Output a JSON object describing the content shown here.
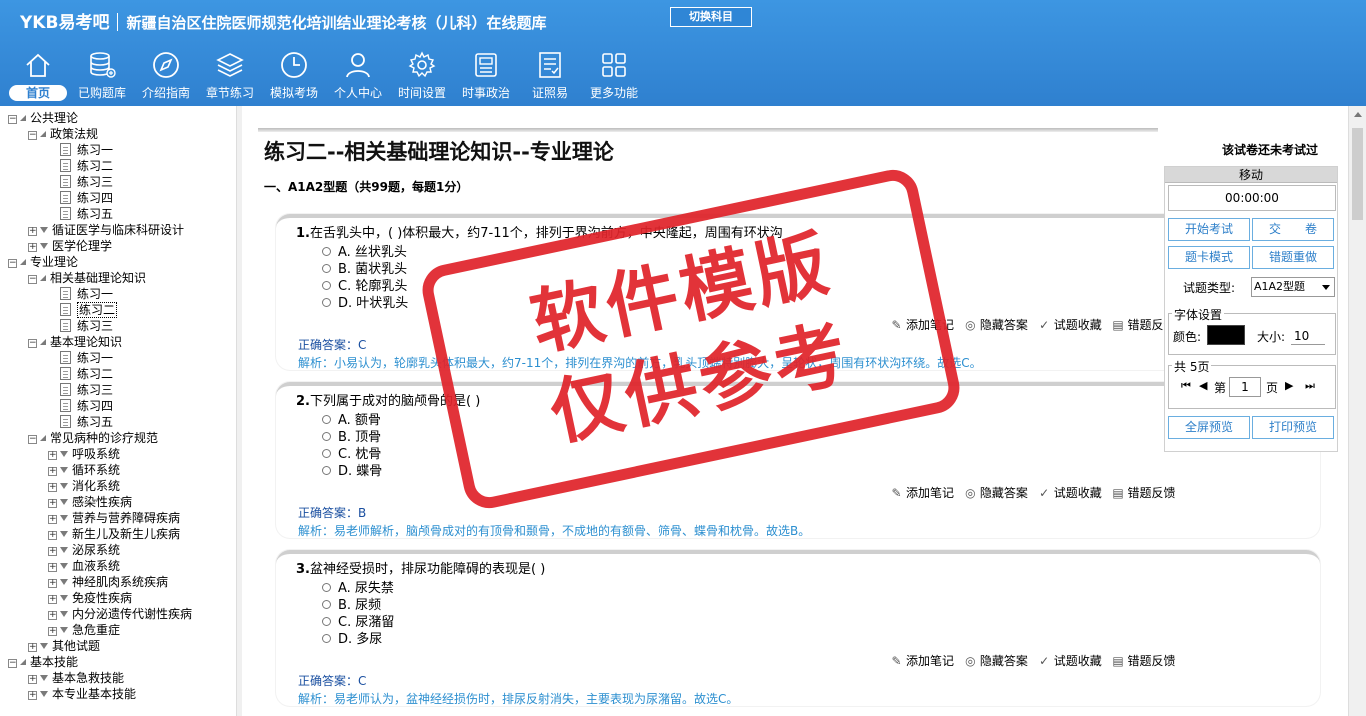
{
  "header": {
    "logo": "YKB易考吧",
    "title": "新疆自治区住院医师规范化培训结业理论考核（儿科）在线题库",
    "switch_label": "切换科目"
  },
  "nav": [
    {
      "label": "首页",
      "icon": "home-icon"
    },
    {
      "label": "已购题库",
      "icon": "database-icon"
    },
    {
      "label": "介绍指南",
      "icon": "compass-icon"
    },
    {
      "label": "章节练习",
      "icon": "layers-icon"
    },
    {
      "label": "模拟考场",
      "icon": "clock-icon"
    },
    {
      "label": "个人中心",
      "icon": "user-icon"
    },
    {
      "label": "时间设置",
      "icon": "gear-icon"
    },
    {
      "label": "时事政治",
      "icon": "news-icon"
    },
    {
      "label": "证照易",
      "icon": "checklist-icon"
    },
    {
      "label": "更多功能",
      "icon": "grid-icon"
    }
  ],
  "tree": [
    {
      "label": "公共理论",
      "level": 0,
      "kind": "folder",
      "toggle": "-"
    },
    {
      "label": "政策法规",
      "level": 1,
      "kind": "folder",
      "toggle": "-"
    },
    {
      "label": "练习一",
      "level": 2,
      "kind": "doc"
    },
    {
      "label": "练习二",
      "level": 2,
      "kind": "doc"
    },
    {
      "label": "练习三",
      "level": 2,
      "kind": "doc"
    },
    {
      "label": "练习四",
      "level": 2,
      "kind": "doc"
    },
    {
      "label": "练习五",
      "level": 2,
      "kind": "doc"
    },
    {
      "label": "循证医学与临床科研设计",
      "level": 1,
      "kind": "closed",
      "toggle": "+"
    },
    {
      "label": "医学伦理学",
      "level": 1,
      "kind": "closed",
      "toggle": "+"
    },
    {
      "label": "专业理论",
      "level": 0,
      "kind": "folder",
      "toggle": "-"
    },
    {
      "label": "相关基础理论知识",
      "level": 1,
      "kind": "folder",
      "toggle": "-"
    },
    {
      "label": "练习一",
      "level": 2,
      "kind": "doc"
    },
    {
      "label": "练习二",
      "level": 2,
      "kind": "doc",
      "selected": true
    },
    {
      "label": "练习三",
      "level": 2,
      "kind": "doc"
    },
    {
      "label": "基本理论知识",
      "level": 1,
      "kind": "folder",
      "toggle": "-"
    },
    {
      "label": "练习一",
      "level": 2,
      "kind": "doc"
    },
    {
      "label": "练习二",
      "level": 2,
      "kind": "doc"
    },
    {
      "label": "练习三",
      "level": 2,
      "kind": "doc"
    },
    {
      "label": "练习四",
      "level": 2,
      "kind": "doc"
    },
    {
      "label": "练习五",
      "level": 2,
      "kind": "doc"
    },
    {
      "label": "常见病种的诊疗规范",
      "level": 1,
      "kind": "folder",
      "toggle": "-"
    },
    {
      "label": "呼吸系统",
      "level": 2,
      "kind": "closed",
      "toggle": "+"
    },
    {
      "label": "循环系统",
      "level": 2,
      "kind": "closed",
      "toggle": "+"
    },
    {
      "label": "消化系统",
      "level": 2,
      "kind": "closed",
      "toggle": "+"
    },
    {
      "label": "感染性疾病",
      "level": 2,
      "kind": "closed",
      "toggle": "+"
    },
    {
      "label": "营养与营养障碍疾病",
      "level": 2,
      "kind": "closed",
      "toggle": "+"
    },
    {
      "label": "新生儿及新生儿疾病",
      "level": 2,
      "kind": "closed",
      "toggle": "+"
    },
    {
      "label": "泌尿系统",
      "level": 2,
      "kind": "closed",
      "toggle": "+"
    },
    {
      "label": "血液系统",
      "level": 2,
      "kind": "closed",
      "toggle": "+"
    },
    {
      "label": "神经肌肉系统疾病",
      "level": 2,
      "kind": "closed",
      "toggle": "+"
    },
    {
      "label": "免疫性疾病",
      "level": 2,
      "kind": "closed",
      "toggle": "+"
    },
    {
      "label": "内分泌遗传代谢性疾病",
      "level": 2,
      "kind": "closed",
      "toggle": "+"
    },
    {
      "label": "急危重症",
      "level": 2,
      "kind": "closed",
      "toggle": "+"
    },
    {
      "label": "其他试题",
      "level": 1,
      "kind": "closed",
      "toggle": "+"
    },
    {
      "label": "基本技能",
      "level": 0,
      "kind": "folder",
      "toggle": "-"
    },
    {
      "label": "基本急救技能",
      "level": 1,
      "kind": "closed",
      "toggle": "+"
    },
    {
      "label": "本专业基本技能",
      "level": 1,
      "kind": "closed",
      "toggle": "+"
    }
  ],
  "paper": {
    "title": "练习二--相关基础理论知识--专业理论",
    "status": "该试卷还未考试过",
    "section": "一、A1A2型题（共99题，每题1分）"
  },
  "questions": [
    {
      "num": "1.",
      "stem": "在舌乳头中，( )体积最大，约7-11个，排列于界沟前方，中央隆起，周围有环状沟",
      "options": [
        "A. 丝状乳头",
        "B. 菌状乳头",
        "C. 轮廓乳头",
        "D. 叶状乳头"
      ],
      "answer": "正确答案：C",
      "analysis": "解析：小易认为，轮廓乳头体积最大，约7-11个，排列在界沟的前方，乳头顶端特别膨大，呈轮状，周围有环状沟环绕。故选C。"
    },
    {
      "num": "2.",
      "stem": "下列属于成对的脑颅骨的是( )",
      "options": [
        "A. 额骨",
        "B. 顶骨",
        "C. 枕骨",
        "D. 蝶骨"
      ],
      "answer": "正确答案：B",
      "analysis": "解析：易老师解析，脑颅骨成对的有顶骨和颞骨，不成地的有额骨、筛骨、蝶骨和枕骨。故选B。"
    },
    {
      "num": "3.",
      "stem": "盆神经受损时，排尿功能障碍的表现是( )",
      "options": [
        "A. 尿失禁",
        "B. 尿频",
        "C. 尿潴留",
        "D. 多尿"
      ],
      "answer": "正确答案：C",
      "analysis": "解析：易老师认为，盆神经经损伤时，排尿反射消失，主要表现为尿潴留。故选C。"
    }
  ],
  "actions": {
    "note": "添加笔记",
    "hide": "隐藏答案",
    "fav": "试题收藏",
    "report": "错题反馈"
  },
  "panel": {
    "move": "移动",
    "timer": "00:00:00",
    "start": "开始考试",
    "submit": "交　　卷",
    "card_mode": "题卡模式",
    "redo_wrong": "错题重做",
    "type_label": "试题类型:",
    "type_value": "A1A2型题",
    "font_legend": "字体设置",
    "color_label": "颜色:",
    "size_label": "大小:",
    "size_value": "10",
    "pages_legend": "共 5页",
    "page_prefix": "第",
    "page_value": "1",
    "page_suffix": "页",
    "fullscreen": "全屏预览",
    "print": "打印预览"
  },
  "watermark": {
    "line1": "软件模版",
    "line2": "仅供参考"
  },
  "colors": {
    "header_blue": "#3b8fd9",
    "answer_text": "#1a4fa0",
    "analysis_text": "#2c8fd0",
    "stamp_red": "#e0242b",
    "button_text": "#2d7fc9"
  }
}
